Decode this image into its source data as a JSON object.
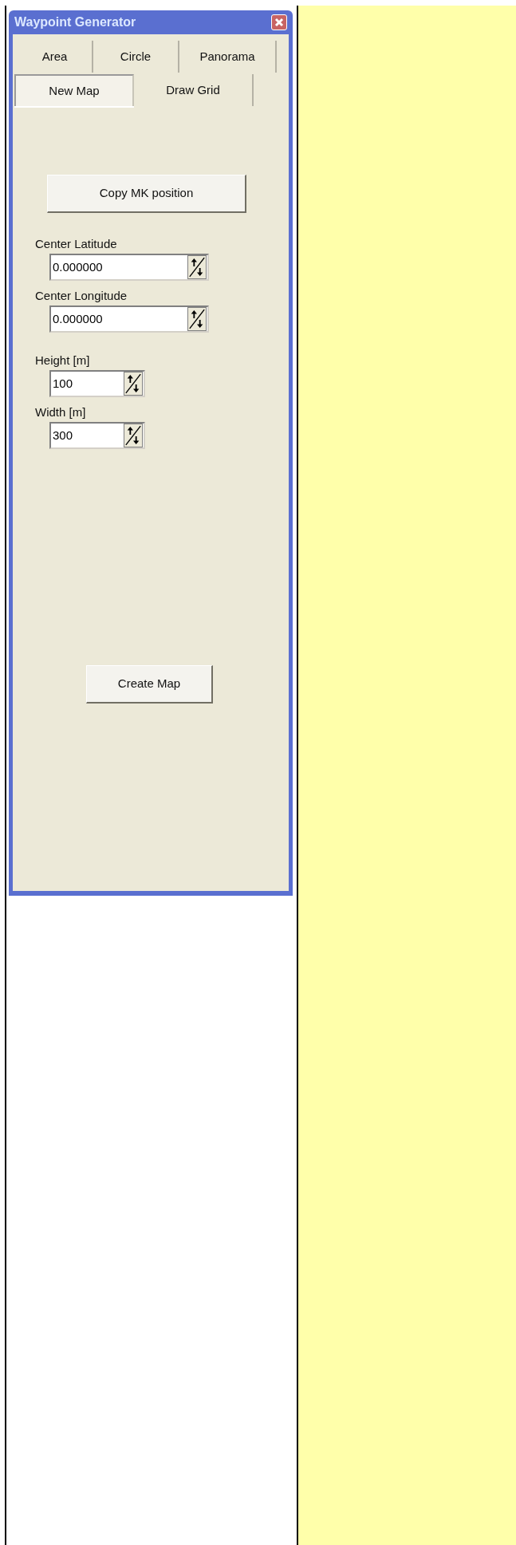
{
  "window": {
    "title": "Waypoint Generator"
  },
  "tab_rows": [
    {
      "tabs": [
        {
          "label": "Area",
          "selected": false
        },
        {
          "label": "Circle",
          "selected": false
        },
        {
          "label": "Panorama",
          "selected": false
        }
      ]
    },
    {
      "tabs": [
        {
          "label": "New Map",
          "selected": true
        },
        {
          "label": "Draw Grid",
          "selected": false
        }
      ]
    }
  ],
  "copy_button": "Copy MK position",
  "fields": [
    {
      "kind": "coordinate",
      "label": "Center Latitude",
      "value": "0.000000"
    },
    {
      "kind": "coordinate",
      "label": "Center Longitude",
      "value": "0.000000"
    },
    {
      "kind": "distance",
      "label": "Height [m]",
      "value": "100"
    },
    {
      "kind": "distance",
      "label": "Width [m]",
      "value": "300"
    }
  ],
  "create_button": "Create Map"
}
